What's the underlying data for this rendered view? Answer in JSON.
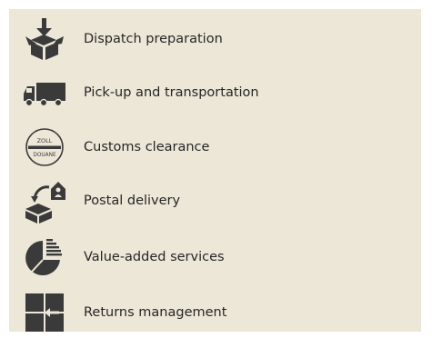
{
  "services": [
    {
      "label": "Dispatch preparation",
      "icon": "box-down-arrow-icon"
    },
    {
      "label": "Pick-up and transportation",
      "icon": "truck-icon"
    },
    {
      "label": "Customs clearance",
      "icon": "customs-seal-icon",
      "seal_top": "ZOLL",
      "seal_bottom": "DOUANE"
    },
    {
      "label": "Postal delivery",
      "icon": "box-to-house-icon"
    },
    {
      "label": "Value-added services",
      "icon": "pie-chart-icon"
    },
    {
      "label": "Returns management",
      "icon": "return-grid-icon"
    }
  ],
  "colors": {
    "background": "#ede7d8",
    "icon": "#3a3a3a",
    "text": "#262626"
  }
}
